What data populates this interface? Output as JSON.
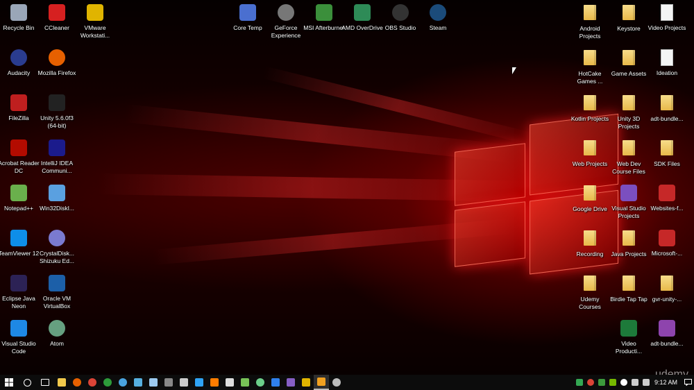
{
  "desktop": {
    "icons_left_col1": [
      {
        "label": "Recycle Bin",
        "icon": "recycle-bin-icon",
        "color": "#9aa6b8"
      },
      {
        "label": "Audacity",
        "icon": "audacity-icon",
        "color": "#2a3c8f"
      },
      {
        "label": "FileZilla",
        "icon": "filezilla-icon",
        "color": "#bf1f1f"
      },
      {
        "label": "Acrobat Reader DC",
        "icon": "acrobat-icon",
        "color": "#b30b00"
      },
      {
        "label": "Notepad++",
        "icon": "notepadpp-icon",
        "color": "#6ab04c"
      },
      {
        "label": "TeamViewer 12",
        "icon": "teamviewer-icon",
        "color": "#0e8ee9"
      },
      {
        "label": "Eclipse Java Neon",
        "icon": "eclipse-icon",
        "color": "#2c2255"
      },
      {
        "label": "Visual Studio Code",
        "icon": "vscode-icon",
        "color": "#1e88e5"
      }
    ],
    "icons_left_col2": [
      {
        "label": "CCleaner",
        "icon": "ccleaner-icon",
        "color": "#d62020"
      },
      {
        "label": "Mozilla Firefox",
        "icon": "firefox-icon",
        "color": "#e66000"
      },
      {
        "label": "Unity 5.6.0f3 (64-bit)",
        "icon": "unity-icon",
        "color": "#222222"
      },
      {
        "label": "IntelliJ IDEA Communi...",
        "icon": "intellij-icon",
        "color": "#1b1b8c"
      },
      {
        "label": "Win32DiskI...",
        "icon": "win32disk-icon",
        "color": "#5aa0e0"
      },
      {
        "label": "CrystalDisk... Shizuku Ed...",
        "icon": "crystaldisk-icon",
        "color": "#7a7ad0"
      },
      {
        "label": "Oracle VM VirtualBox",
        "icon": "virtualbox-icon",
        "color": "#1c5fa8"
      },
      {
        "label": "Atom",
        "icon": "atom-icon",
        "color": "#66a080"
      }
    ],
    "icons_left_col3": [
      {
        "label": "VMware Workstati...",
        "icon": "vmware-icon",
        "color": "#e0b400"
      }
    ],
    "icons_top": [
      {
        "label": "Core Temp",
        "icon": "coretemp-icon",
        "color": "#4a6fd0"
      },
      {
        "label": "GeForce Experience",
        "icon": "geforce-icon",
        "color": "#777777"
      },
      {
        "label": "MSI Afterburner",
        "icon": "msi-icon",
        "color": "#3b8f3b"
      },
      {
        "label": "AMD OverDrive",
        "icon": "amd-icon",
        "color": "#2e8b57"
      },
      {
        "label": "OBS Studio",
        "icon": "obs-icon",
        "color": "#333333"
      },
      {
        "label": "Steam",
        "icon": "steam-icon",
        "color": "#1b4b7a"
      }
    ],
    "icons_right_col1": [
      {
        "label": "Android Projects",
        "icon": "folder-icon",
        "type": "folder"
      },
      {
        "label": "HotCake Games ...",
        "icon": "folder-icon",
        "type": "folder"
      },
      {
        "label": "Kotlin Projects",
        "icon": "folder-icon",
        "type": "folder"
      },
      {
        "label": "Web Projects",
        "icon": "folder-icon",
        "type": "folder"
      },
      {
        "label": "Google Drive",
        "icon": "google-drive-folder-icon",
        "type": "folder"
      },
      {
        "label": "Recording",
        "icon": "folder-icon",
        "type": "folder"
      },
      {
        "label": "Udemy Courses",
        "icon": "folder-icon",
        "type": "folder"
      }
    ],
    "icons_right_col2": [
      {
        "label": "Keystore",
        "icon": "folder-icon",
        "type": "folder"
      },
      {
        "label": "Game Assets",
        "icon": "folder-icon",
        "type": "folder"
      },
      {
        "label": "Unity 3D Projects",
        "icon": "folder-icon",
        "type": "folder"
      },
      {
        "label": "Web Dev Course Files",
        "icon": "folder-icon",
        "type": "folder"
      },
      {
        "label": "Visual Studio Projects",
        "icon": "visual-studio-icon",
        "type": "app",
        "color": "#7b4fbf"
      },
      {
        "label": "Java Projects",
        "icon": "folder-icon",
        "type": "folder"
      },
      {
        "label": "Birdie Tap Tap",
        "icon": "folder-icon",
        "type": "folder"
      },
      {
        "label": "Video Producti...",
        "icon": "excel-icon",
        "type": "app",
        "color": "#1d7a3a"
      }
    ],
    "icons_right_col3": [
      {
        "label": "Video Projects",
        "icon": "document-icon",
        "type": "doc"
      },
      {
        "label": "Ideation",
        "icon": "document-icon",
        "type": "doc"
      },
      {
        "label": "adt-bundle...",
        "icon": "folder-icon",
        "type": "folder"
      },
      {
        "label": "SDK Files",
        "icon": "folder-icon",
        "type": "folder"
      },
      {
        "label": "Websites-f...",
        "icon": "pdf-icon",
        "type": "app",
        "color": "#c62828"
      },
      {
        "label": "Microsoft-...",
        "icon": "pdf-icon",
        "type": "app",
        "color": "#c62828"
      },
      {
        "label": "gvr-unity-...",
        "icon": "folder-icon",
        "type": "folder"
      },
      {
        "label": "adt-bundle...",
        "icon": "archive-icon",
        "type": "app",
        "color": "#8e44ad"
      }
    ]
  },
  "taskbar": {
    "pinned": [
      {
        "name": "search-icon",
        "color": "#ffffff"
      },
      {
        "name": "task-view-icon",
        "color": "#ffffff"
      },
      {
        "name": "file-explorer-icon",
        "color": "#f2c94c"
      },
      {
        "name": "firefox-icon",
        "color": "#e66000"
      },
      {
        "name": "chrome-icon",
        "color": "#db4437"
      },
      {
        "name": "edge-icon",
        "color": "#2d9b3a"
      },
      {
        "name": "globe-icon",
        "color": "#4aa3df"
      },
      {
        "name": "remote-icon",
        "color": "#57b0e0"
      },
      {
        "name": "network-icon",
        "color": "#9ccaf0"
      },
      {
        "name": "cmd-icon",
        "color": "#888888"
      },
      {
        "name": "settings-icon",
        "color": "#cccccc"
      },
      {
        "name": "photoshop-icon",
        "color": "#2fa3f5"
      },
      {
        "name": "illustrator-icon",
        "color": "#ff7c00"
      },
      {
        "name": "unity-icon",
        "color": "#dddddd"
      },
      {
        "name": "android-studio-icon",
        "color": "#78c257"
      },
      {
        "name": "atom-icon",
        "color": "#6ccf8a"
      },
      {
        "name": "download-icon",
        "color": "#2f80ed"
      },
      {
        "name": "visual-studio-icon",
        "color": "#865fc5"
      },
      {
        "name": "vmware-icon",
        "color": "#e0b400"
      },
      {
        "name": "recorder-icon",
        "color": "#f0a020"
      },
      {
        "name": "obs-icon",
        "color": "#bbbbbb"
      }
    ],
    "tray": [
      {
        "name": "google-drive-icon",
        "color": "#34a853"
      },
      {
        "name": "chrome-tray-icon",
        "color": "#db4437"
      },
      {
        "name": "green-app-icon",
        "color": "#3c9a3c"
      },
      {
        "name": "nvidia-icon",
        "color": "#76b900"
      },
      {
        "name": "cloud-icon",
        "color": "#ffffff"
      },
      {
        "name": "battery-icon",
        "color": "#cccccc"
      },
      {
        "name": "volume-icon",
        "color": "#cccccc"
      }
    ],
    "clock": "9:12 AM"
  },
  "watermark": "udemy"
}
